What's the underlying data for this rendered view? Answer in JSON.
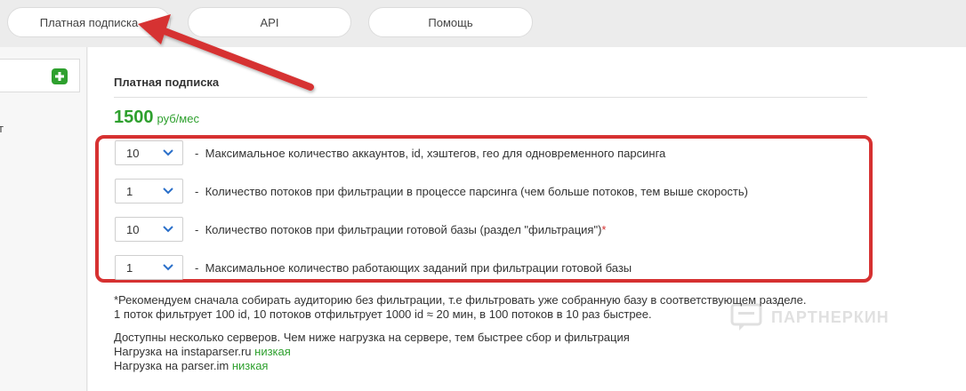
{
  "nav": {
    "tabs": [
      {
        "label": "Платная подписка"
      },
      {
        "label": "API"
      },
      {
        "label": "Помощь"
      }
    ]
  },
  "sidebar": {
    "partial_text": "т"
  },
  "section": {
    "title": "Платная подписка",
    "price": "1500",
    "price_unit": "руб/мес"
  },
  "options": [
    {
      "value": "10",
      "label": "Максимальное количество аккаунтов, id, хэштегов, гео для одновременного парсинга"
    },
    {
      "value": "1",
      "label": "Количество потоков при фильтрации в процессе парсинга (чем больше потоков, тем выше скорость)"
    },
    {
      "value": "10",
      "label": "Количество потоков при фильтрации готовой базы (раздел \"фильтрация\")",
      "asterisk": "*"
    },
    {
      "value": "1",
      "label": "Максимальное количество работающих заданий при фильтрации готовой базы"
    }
  ],
  "option_separator": "-",
  "notes": {
    "recommend_1": "*Рекомендуем сначала собирать аудиторию без фильтрации, т.е фильтровать уже собранную базу в соответствующем разделе.",
    "recommend_2": "1 поток фильтрует 100 id, 10 потоков отфильтрует 1000 id ≈ 20 мин, в 100 потоков в 10 раз быстрее.",
    "servers": "Доступны несколько серверов. Чем ниже нагрузка на сервере, тем быстрее сбор и фильтрация",
    "load1_label": "Нагрузка на instaparser.ru",
    "load1_value": "низкая",
    "load2_label": "Нагрузка на parser.im",
    "load2_value": "низкая"
  },
  "watermark": "ПАРТНЕРКИН",
  "colors": {
    "accent_green": "#2ea02e",
    "highlight_red": "#d63131"
  },
  "icons": {
    "add": "plus-square-icon",
    "select": "chevron-down-icon",
    "annotation": "red-arrow-icon"
  }
}
